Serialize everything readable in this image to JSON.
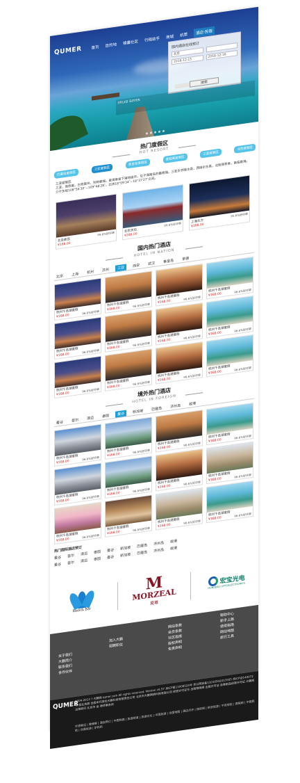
{
  "nav": {
    "logo": "QUMER",
    "items": [
      "首页",
      "目的地",
      "锦囊社区",
      "行程助手",
      "商城",
      "机票",
      "酒店·民宿"
    ],
    "active_index": 6
  },
  "booking": {
    "title": "国内酒店在线预订",
    "city_label": "城市",
    "city_value": "北京",
    "checkin": "2016-12-15",
    "checkout": "2016-12-16",
    "keyword": "",
    "button": "搜索"
  },
  "hero_caption": "3月12日  马尔代夫",
  "hot_resort": {
    "title": "热门度假区",
    "subtitle": "HOT RESORT",
    "pills": [
      "巴厘岛度假区",
      "三亚度假区",
      "普吉岛度假区",
      "夏威夷度假区",
      "三亚度假区",
      "北京度假区"
    ],
    "active_pill": 1,
    "intro_title": "三亚度假区",
    "intro": "三亚，简称崖，古称崖州，别称鹿城，是海南省下辖地级市，位于海南岛的最南端。三亚东邻陵水县，西接乐东县，北毗保亭县，南临南海。介于东经108°56′30″~109°48′28″，北纬18°09′34″~18°37′27″之间。",
    "cards": [
      {
        "name": "北京故宫",
        "price": "¥168.00",
        "rating": "99.6%好评率"
      },
      {
        "name": "北京天坛",
        "price": "¥288.00",
        "rating": "99.6%好评率"
      },
      {
        "name": "上海东方",
        "price": "¥368.00",
        "rating": "95.6%好评率"
      }
    ]
  },
  "domestic": {
    "title": "国内热门酒店",
    "subtitle": "HOTEL IN NATION",
    "tabs": [
      "北京",
      "上海",
      "杭州",
      "苏州",
      "三亚",
      "西安",
      "武汉",
      "秦皇岛",
      "承德"
    ],
    "active_tab": 4,
    "cards": [
      {
        "name": "杭州千岛湖度假",
        "price": "¥168.00",
        "rating": "96.6%好评率"
      },
      {
        "name": "杭州千岛湖度假",
        "price": "¥168.00",
        "rating": "96.6%好评率"
      },
      {
        "name": "杭州千岛湖度假",
        "price": "¥168.00",
        "rating": "96.6%好评率"
      },
      {
        "name": "杭州千岛湖度假",
        "price": "¥168.00",
        "rating": "96.6%好评率"
      },
      {
        "name": "杭州千岛湖度假",
        "price": "¥168.00",
        "rating": "96.6%好评率"
      },
      {
        "name": "杭州千岛湖度假",
        "price": "¥168.00",
        "rating": "96.6%好评率"
      },
      {
        "name": "杭州千岛湖度假",
        "price": "¥168.00",
        "rating": "96.6%好评率"
      },
      {
        "name": "杭州千岛湖度假",
        "price": "¥168.00",
        "rating": "96.6%好评率"
      },
      {
        "name": "杭州千岛湖度假",
        "price": "¥168.00",
        "rating": "96.6%好评率"
      },
      {
        "name": "杭州千岛湖度假",
        "price": "¥168.00",
        "rating": "96.6%好评率"
      },
      {
        "name": "杭州千岛湖度假",
        "price": "¥168.00",
        "rating": "96.6%好评率"
      },
      {
        "name": "杭州千岛湖度假",
        "price": "¥168.00",
        "rating": "96.6%好评率"
      }
    ]
  },
  "foreign": {
    "title": "境外热门酒店",
    "subtitle": "HOTEL IN FOREIGN",
    "tabs": [
      "曼谷",
      "首尔",
      "清迈",
      "泰国",
      "曼谷",
      "新加坡",
      "巴厘岛",
      "济州岛",
      "岘港"
    ],
    "active_tab": 4,
    "cards": [
      {
        "name": "杭州千岛湖度假",
        "price": "¥168.00",
        "rating": "96.6%好评率"
      },
      {
        "name": "杭州千岛湖度假",
        "price": "¥168.00",
        "rating": "96.6%好评率"
      },
      {
        "name": "杭州千岛湖度假",
        "price": "¥168.00",
        "rating": "96.6%好评率"
      },
      {
        "name": "杭州千岛湖度假",
        "price": "¥168.00",
        "rating": "96.6%好评率"
      },
      {
        "name": "杭州千岛湖度假",
        "price": "¥168.00",
        "rating": "96.6%好评率"
      },
      {
        "name": "杭州千岛湖度假",
        "price": "¥168.00",
        "rating": "96.6%好评率"
      },
      {
        "name": "杭州千岛湖度假",
        "price": "¥168.00",
        "rating": "96.6%好评率"
      },
      {
        "name": "杭州千岛湖度假",
        "price": "¥168.00",
        "rating": "96.6%好评率"
      },
      {
        "name": "杭州千岛湖度假",
        "price": "¥168.00",
        "rating": "96.6%好评率"
      },
      {
        "name": "杭州千岛湖度假",
        "price": "¥168.00",
        "rating": "96.6%好评率"
      },
      {
        "name": "杭州千岛湖度假",
        "price": "¥168.00",
        "rating": "96.6%好评率"
      },
      {
        "name": "杭州千岛湖度假",
        "price": "¥168.00",
        "rating": "96.6%好评率"
      }
    ]
  },
  "overseas_booking": {
    "title": "热门国际酒店预订",
    "rows": [
      [
        "曼谷",
        "首尔",
        "清迈",
        "泰国",
        "曼谷",
        "新加坡",
        "巴厘岛",
        "济州岛",
        "岘港"
      ],
      [
        "曼谷",
        "首尔",
        "清迈",
        "泰国",
        "曼谷",
        "新加坡",
        "巴厘岛",
        "济州岛",
        "岘港"
      ]
    ]
  },
  "partners": {
    "bookbar": "Book& Bar",
    "morzeal_en": "MORZEAL",
    "morzeal_cn": "莫尊",
    "hongbao_cn": "宏宝光电",
    "hongbao_en": "HONGBAO OPTOELECTRONICS"
  },
  "footer": {
    "col1": [
      "关于我们",
      "大鹏简介",
      "联系我们",
      "合作伙伴"
    ],
    "col2": [
      "加入大鹏",
      "招聘职位"
    ],
    "col3": [
      "网站条款",
      "会员条款",
      "社区指南",
      "版权声明",
      "免责声明"
    ],
    "col4": [
      "帮助中心",
      "新手上路",
      "使用指南",
      "网站地图",
      "旅行工具"
    ],
    "logo": "QUMER",
    "copyright": "2004-2013 ? 大鹏网 tqmer.com All rights reserved. Version v5.57 京ICP备11008524号 京公网安备11010502013505 京ICP证140072号 营业执照 出版本开放社大鹏科技有限责任公司 北京市大鹏网络科技有限公司 经营许可证号 出版物网络 出版许可证 音像制品经营许可证 大鹏网 法律顾问 北京市 金 律师事务所",
    "links": "交通客运 | 微博客 | 酒店预订 | 中国铁路 | 旅游频道 | 旅游论坛 | 中国旅游 | 全国地图 | 酒店点评 | 搜房网 | 新浪旅游 | 平安保险 | 携程网 | 中国民航 | 凤凰旅游 | 驴妈妈"
  }
}
